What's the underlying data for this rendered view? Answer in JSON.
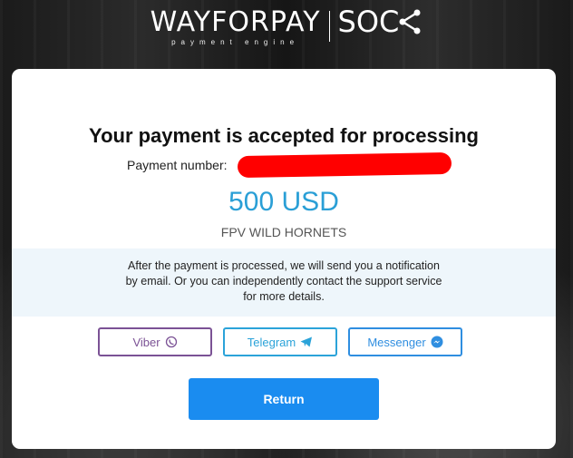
{
  "header": {
    "logo_main": "WAYFORPAY",
    "logo_sub": "payment engine",
    "partner_logo": "SOC"
  },
  "payment": {
    "title": "Your payment is accepted for processing",
    "number_label": "Payment number:",
    "amount": "500 USD",
    "merchant": "FPV WILD HORNETS"
  },
  "info": {
    "text": "After the payment is processed, we will send you a notification by email. Or you can independently contact the support service for more details."
  },
  "support_buttons": {
    "viber": "Viber",
    "telegram": "Telegram",
    "messenger": "Messenger"
  },
  "actions": {
    "return_label": "Return"
  },
  "colors": {
    "accent_blue": "#1a8cf0",
    "amount_blue": "#2a9fd6",
    "viber_purple": "#7b5295",
    "redaction": "#ff0000"
  }
}
